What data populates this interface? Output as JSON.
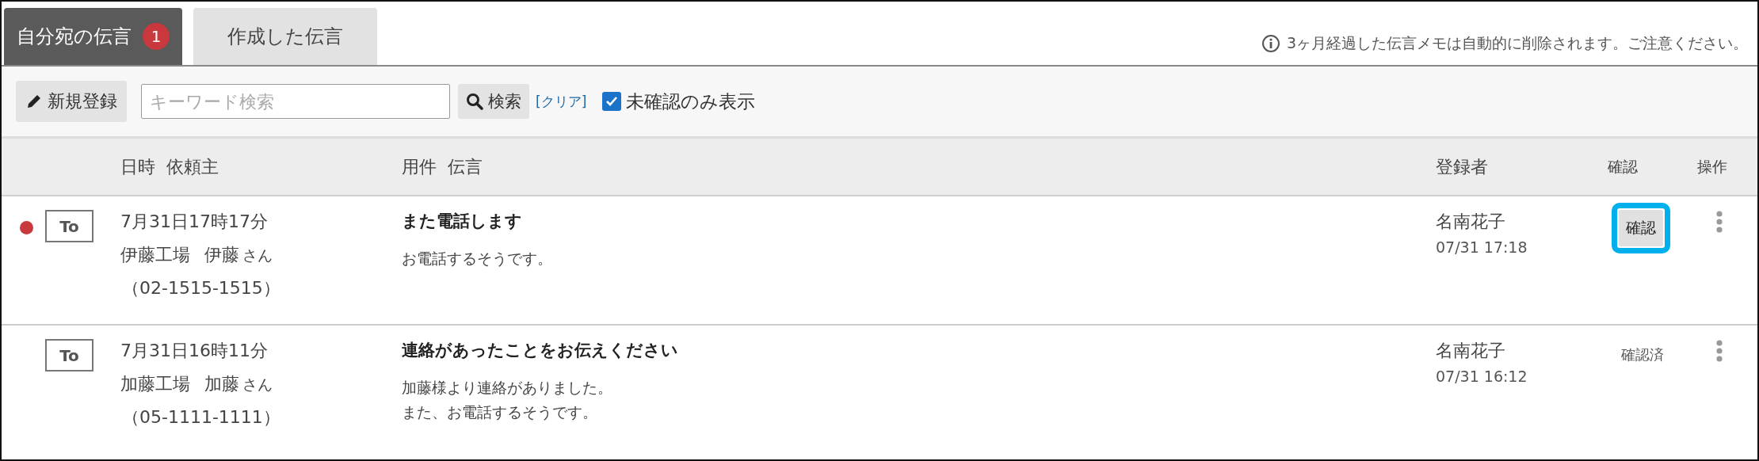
{
  "tabs": [
    {
      "label": "自分宛の伝言",
      "badge": "1",
      "selected": true
    },
    {
      "label": "作成した伝言",
      "selected": false
    }
  ],
  "notice": "3ヶ月経過した伝言メモは自動的に削除されます。ご注意ください。",
  "toolbar": {
    "new_button": "新規登録",
    "search": {
      "placeholder": "キーワード検索"
    },
    "search_button": "検索",
    "clear_link": "[クリア]",
    "unconfirmed_only": {
      "label": "未確認のみ表示",
      "checked": true
    }
  },
  "table": {
    "columns": [
      "日時",
      "依頼主",
      "用件",
      "伝言",
      "登録者",
      "確認",
      "操作"
    ],
    "rows": [
      {
        "unread": true,
        "to": "To",
        "datetime": "7月31日17時17分",
        "company": "伊藤工場",
        "person": "伊藤",
        "honorific": "さん",
        "phone": "（02-1515-1515）",
        "subject": "また電話します",
        "message_lines": [
          "お電話するそうです。"
        ],
        "registrant": "名南花子",
        "registered_at": "07/31 17:18",
        "confirm": {
          "kind": "button",
          "label": "確認",
          "highlighted": true
        }
      },
      {
        "unread": false,
        "to": "To",
        "datetime": "7月31日16時11分",
        "company": "加藤工場",
        "person": "加藤",
        "honorific": "さん",
        "phone": "（05-1111-1111）",
        "subject": "連絡があったことをお伝えください",
        "message_lines": [
          "加藤様より連絡がありました。",
          "また、お電話するそうです。"
        ],
        "registrant": "名南花子",
        "registered_at": "07/31 16:12",
        "confirm": {
          "kind": "status",
          "label": "確認済",
          "highlighted": false
        }
      }
    ]
  }
}
